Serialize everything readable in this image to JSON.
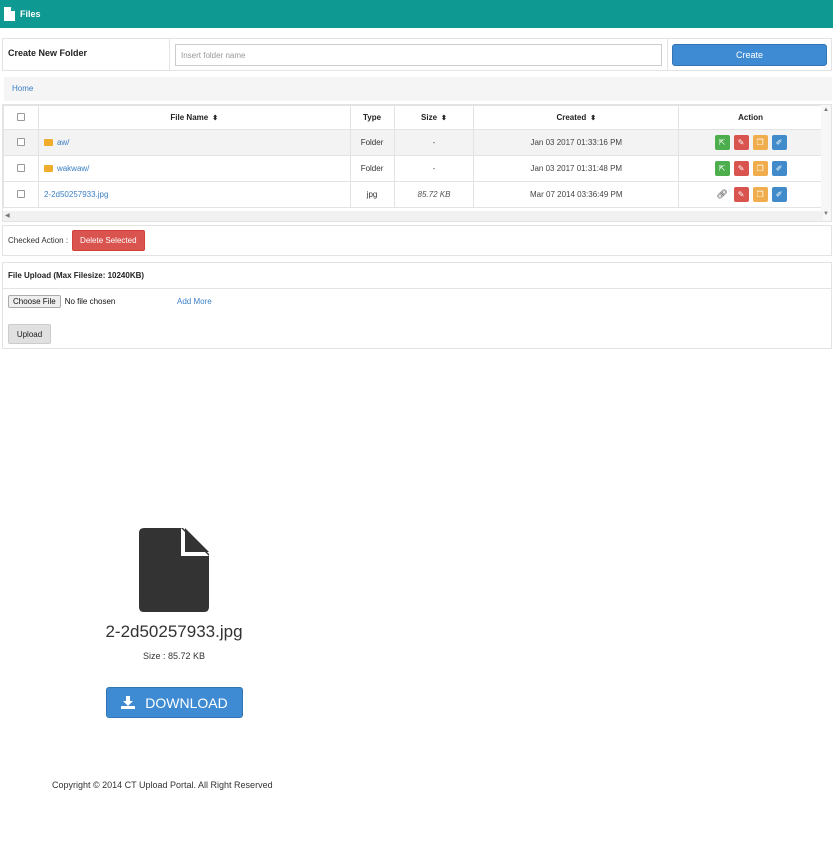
{
  "header": {
    "title": "Files",
    "icon": "file-icon",
    "color": "#0e9a92"
  },
  "create_folder": {
    "label": "Create New Folder",
    "placeholder": "Insert folder name",
    "button": "Create"
  },
  "breadcrumb": {
    "home": "Home"
  },
  "table": {
    "headers": {
      "name": "File Name",
      "type": "Type",
      "size": "Size",
      "created": "Created",
      "action": "Action"
    },
    "rows": [
      {
        "name": "aw/",
        "type": "Folder",
        "size": "-",
        "created": "Jan 03 2017 01:33:16 PM"
      },
      {
        "name": "wakwaw/",
        "type": "Folder",
        "size": "-",
        "created": "Jan 03 2017 01:31:48 PM"
      },
      {
        "name": "2-2d50257933.jpg",
        "type": "jpg",
        "size": "85.72 KB",
        "created": "Mar 07 2014 03:36:49 PM"
      }
    ]
  },
  "bulk": {
    "label": "Checked Action :",
    "delete_button": "Delete Selected"
  },
  "upload": {
    "title": "File Upload (Max Filesize: 10240KB)",
    "choose_button": "Choose File",
    "no_file": "No file chosen",
    "add_more": "Add More",
    "upload_button": "Upload"
  },
  "preview": {
    "filename": "2-2d50257933.jpg",
    "size": "Size : 85.72 KB",
    "download": "DOWNLOAD"
  },
  "footer": {
    "copyright": "Copyright © 2014 CT Upload Portal. All Right Reserved"
  }
}
